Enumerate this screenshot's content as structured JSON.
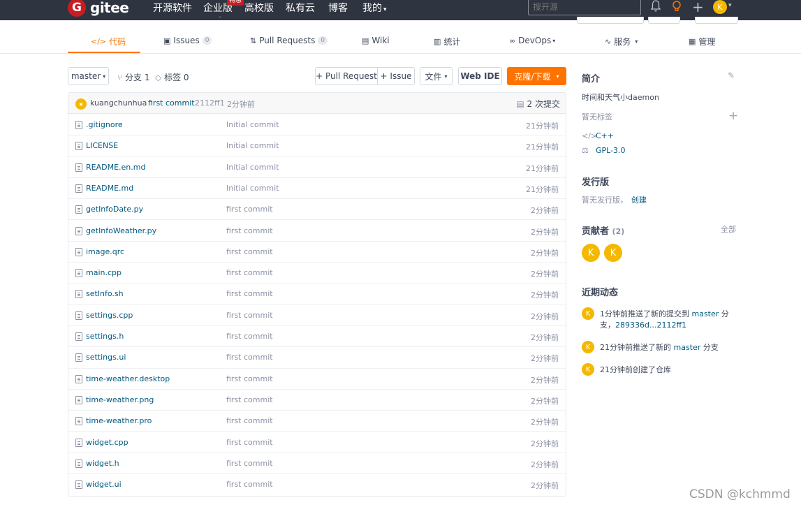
{
  "topnav": {
    "logo_glyph": "G",
    "logo_text": "gitee",
    "links": [
      "开源软件",
      "企业版",
      "高校版",
      "私有云",
      "博客",
      "我的"
    ],
    "badge": "特惠",
    "search_placeholder": "搜开源",
    "avatar": "K"
  },
  "tabs": [
    {
      "label": "代码",
      "count": ""
    },
    {
      "label": "Issues",
      "count": "0"
    },
    {
      "label": "Pull Requests",
      "count": "0"
    },
    {
      "label": "Wiki",
      "count": ""
    },
    {
      "label": "统计",
      "count": ""
    },
    {
      "label": "DevOps",
      "count": ""
    },
    {
      "label": "服务",
      "count": ""
    },
    {
      "label": "管理",
      "count": ""
    }
  ],
  "toolbar": {
    "branch": "master",
    "branches": "分支 1",
    "tags": "标签 0",
    "pull_request": "+ Pull Request",
    "issue": "+ Issue",
    "file": "文件",
    "web_ide": "Web IDE",
    "clone": "克隆/下载"
  },
  "commit": {
    "author_avatar": "★",
    "author": "kuangchunhua",
    "message": "first commit",
    "sha": "2112ff1",
    "time": "2分钟前",
    "count": "2 次提交"
  },
  "files": [
    {
      "name": ".gitignore",
      "message": "Initial commit",
      "time": "21分钟前"
    },
    {
      "name": "LICENSE",
      "message": "Initial commit",
      "time": "21分钟前"
    },
    {
      "name": "README.en.md",
      "message": "Initial commit",
      "time": "21分钟前"
    },
    {
      "name": "README.md",
      "message": "Initial commit",
      "time": "21分钟前"
    },
    {
      "name": "getInfoDate.py",
      "message": "first commit",
      "time": "2分钟前"
    },
    {
      "name": "getInfoWeather.py",
      "message": "first commit",
      "time": "2分钟前"
    },
    {
      "name": "image.qrc",
      "message": "first commit",
      "time": "2分钟前"
    },
    {
      "name": "main.cpp",
      "message": "first commit",
      "time": "2分钟前"
    },
    {
      "name": "setInfo.sh",
      "message": "first commit",
      "time": "2分钟前"
    },
    {
      "name": "settings.cpp",
      "message": "first commit",
      "time": "2分钟前"
    },
    {
      "name": "settings.h",
      "message": "first commit",
      "time": "2分钟前"
    },
    {
      "name": "settings.ui",
      "message": "first commit",
      "time": "2分钟前"
    },
    {
      "name": "time-weather.desktop",
      "message": "first commit",
      "time": "2分钟前"
    },
    {
      "name": "time-weather.png",
      "message": "first commit",
      "time": "2分钟前"
    },
    {
      "name": "time-weather.pro",
      "message": "first commit",
      "time": "2分钟前"
    },
    {
      "name": "widget.cpp",
      "message": "first commit",
      "time": "2分钟前"
    },
    {
      "name": "widget.h",
      "message": "first commit",
      "time": "2分钟前"
    },
    {
      "name": "widget.ui",
      "message": "first commit",
      "time": "2分钟前"
    }
  ],
  "sidebar": {
    "intro_title": "简介",
    "description": "时间和天气小daemon",
    "no_tags": "暂无标签",
    "language": "C++",
    "license": "GPL-3.0",
    "releases_title": "发行版",
    "no_releases": "暂无发行版，",
    "create": "创建",
    "contributors_title": "贡献者",
    "contributors_count": "(2)",
    "all": "全部",
    "contributors": [
      "K",
      "K"
    ],
    "activity_title": "近期动态",
    "activity": [
      {
        "avatar": "K",
        "pre": "1分钟前推送了新的提交到 ",
        "branch": "master",
        "post": " 分支，",
        "link": "289336d...2112ff1"
      },
      {
        "avatar": "K",
        "pre": "21分钟前推送了新的 ",
        "branch": "master",
        "post": " 分支",
        "link": ""
      },
      {
        "avatar": "K",
        "pre": "21分钟前创建了仓库",
        "branch": "",
        "post": "",
        "link": ""
      }
    ]
  },
  "watermark": "CSDN @kchmmd",
  "colors": {
    "accent": "#fe7300",
    "nav_bg": "#2e3440",
    "link": "#005980",
    "brand_red": "#c71d23",
    "avatar": "#f5b800"
  }
}
